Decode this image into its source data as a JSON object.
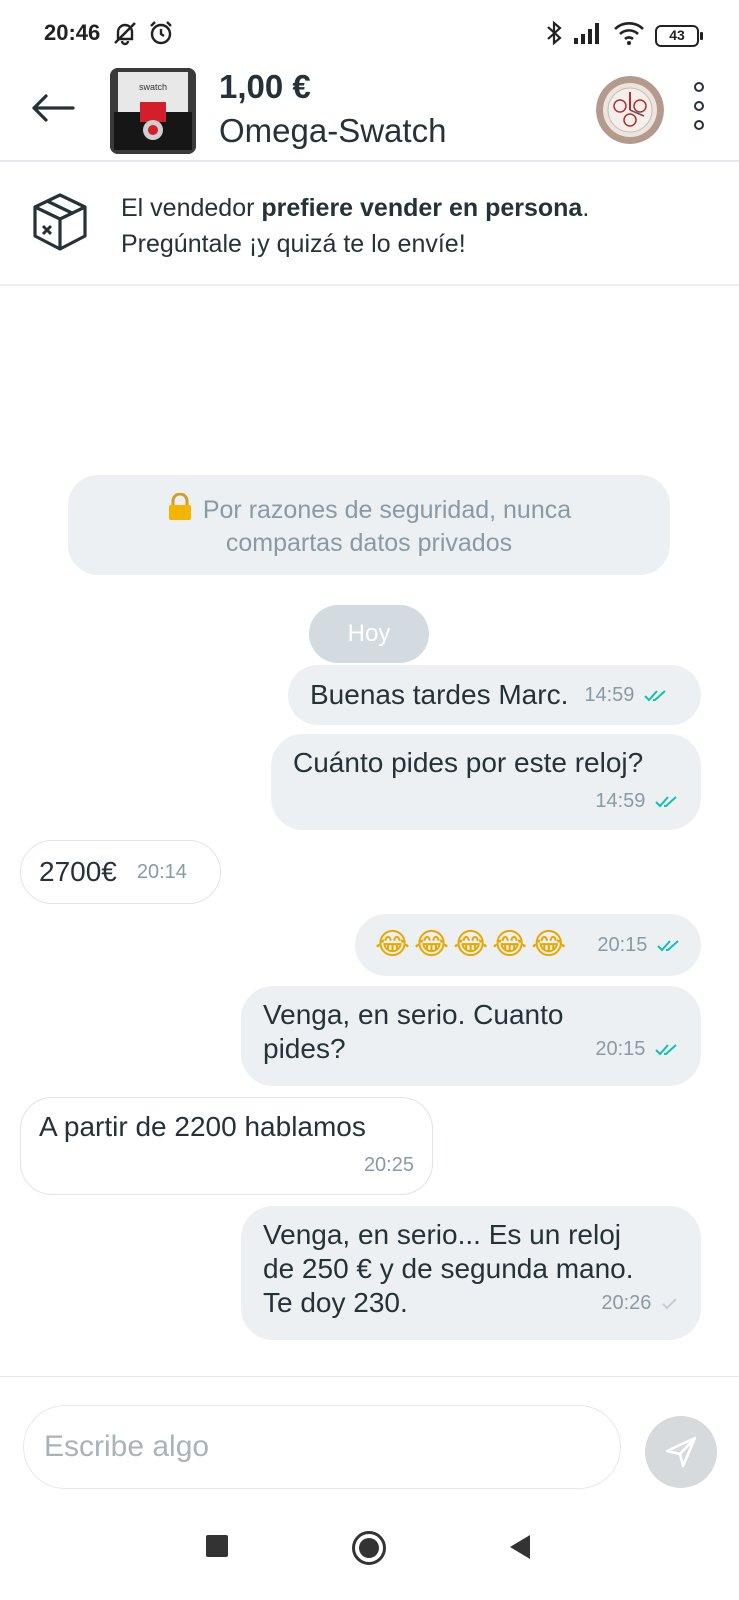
{
  "status_bar": {
    "time": "20:46",
    "battery": "43"
  },
  "header": {
    "price": "1,00 €",
    "product_name": "Omega-Swatch",
    "thumb_label": "swatch"
  },
  "banner": {
    "line1_prefix": "El vendedor ",
    "line1_bold": "prefiere vender en persona",
    "line1_suffix": ".",
    "line2": "Pregúntale ¡y quizá te lo envíe!"
  },
  "chat": {
    "security_line1": "Por razones de seguridad, nunca",
    "security_line2": "compartas datos privados",
    "day_label": "Hoy",
    "messages": [
      {
        "direction": "out",
        "text": "Buenas tardes Marc.",
        "time": "14:59",
        "status": "read"
      },
      {
        "direction": "out",
        "text": "Cuánto pides por este reloj?",
        "time": "14:59",
        "status": "read"
      },
      {
        "direction": "in",
        "text": "2700€",
        "time": "20:14"
      },
      {
        "direction": "out",
        "text": "😂😂😂😂😂",
        "time": "20:15",
        "status": "read"
      },
      {
        "direction": "out",
        "text_line1": "Venga, en serio. Cuanto",
        "text_line2": "pides?",
        "time": "20:15",
        "status": "read"
      },
      {
        "direction": "in",
        "text": "A partir de 2200 hablamos",
        "time": "20:25"
      },
      {
        "direction": "out",
        "text_line1": "Venga, en serio... Es un reloj",
        "text_line2": "de 250 € y de segunda mano.",
        "text_line3": "Te doy 230.",
        "time": "20:26",
        "status": "delivered"
      }
    ]
  },
  "composer": {
    "placeholder": "Escribe algo"
  },
  "colors": {
    "text_primary": "#253238",
    "bubble_out": "#ecf0f3",
    "read_tick": "#13c1ac",
    "lock": "#f5b400"
  }
}
